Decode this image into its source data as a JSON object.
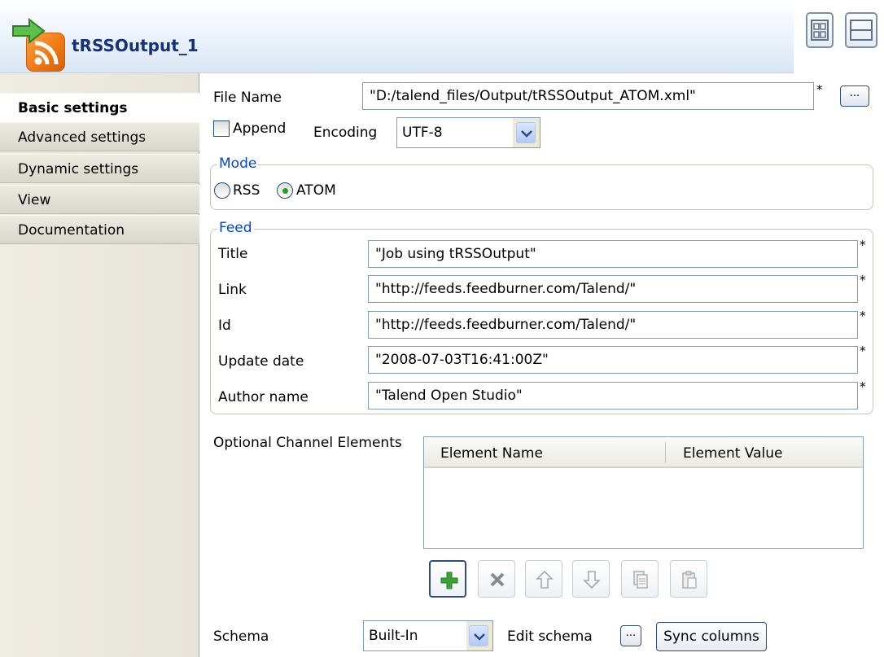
{
  "header": {
    "title": "tRSSOutput_1",
    "component_icon": "rss-feed-icon",
    "arrow_icon": "green-arrow-icon",
    "layout_buttons": [
      "grid-layout-icon",
      "split-layout-icon"
    ]
  },
  "sidebar": {
    "items": [
      {
        "label": "Basic settings",
        "active": true
      },
      {
        "label": "Advanced settings",
        "active": false
      },
      {
        "label": "Dynamic settings",
        "active": false
      },
      {
        "label": "View",
        "active": false
      },
      {
        "label": "Documentation",
        "active": false
      }
    ]
  },
  "file": {
    "label": "File Name",
    "value": "\"D:/talend_files/Output/tRSSOutput_ATOM.xml\"",
    "required_mark": "*",
    "browse_label": "..."
  },
  "append": {
    "label": "Append",
    "checked": false
  },
  "encoding": {
    "label": "Encoding",
    "value": "UTF-8"
  },
  "mode": {
    "legend": "Mode",
    "options": [
      {
        "label": "RSS",
        "selected": false
      },
      {
        "label": "ATOM",
        "selected": true
      }
    ]
  },
  "feed": {
    "legend": "Feed",
    "required_mark": "*",
    "fields": [
      {
        "label": "Title",
        "value": "\"Job using tRSSOutput\""
      },
      {
        "label": "Link",
        "value": "\"http://feeds.feedburner.com/Talend/\""
      },
      {
        "label": "Id",
        "value": "\"http://feeds.feedburner.com/Talend/\""
      },
      {
        "label": "Update date",
        "value": "\"2008-07-03T16:41:00Z\""
      },
      {
        "label": "Author name",
        "value": "\"Talend Open Studio\""
      }
    ]
  },
  "channel_elements": {
    "label": "Optional Channel Elements",
    "columns": [
      "Element Name",
      "Element Value"
    ],
    "rows": [],
    "toolbar": [
      {
        "name": "add-icon",
        "enabled": true
      },
      {
        "name": "delete-icon",
        "enabled": false
      },
      {
        "name": "move-up-icon",
        "enabled": false
      },
      {
        "name": "move-down-icon",
        "enabled": false
      },
      {
        "name": "copy-icon",
        "enabled": false
      },
      {
        "name": "paste-icon",
        "enabled": false
      }
    ]
  },
  "schema": {
    "label": "Schema",
    "value": "Built-In",
    "edit_label": "Edit schema",
    "edit_button": "...",
    "sync_label": "Sync columns"
  },
  "colors": {
    "header_title": "#17307a",
    "legend": "#0046d5",
    "radio_dot": "#21a121",
    "rss_orange": "#f07a14",
    "add_green": "#3aa335"
  }
}
